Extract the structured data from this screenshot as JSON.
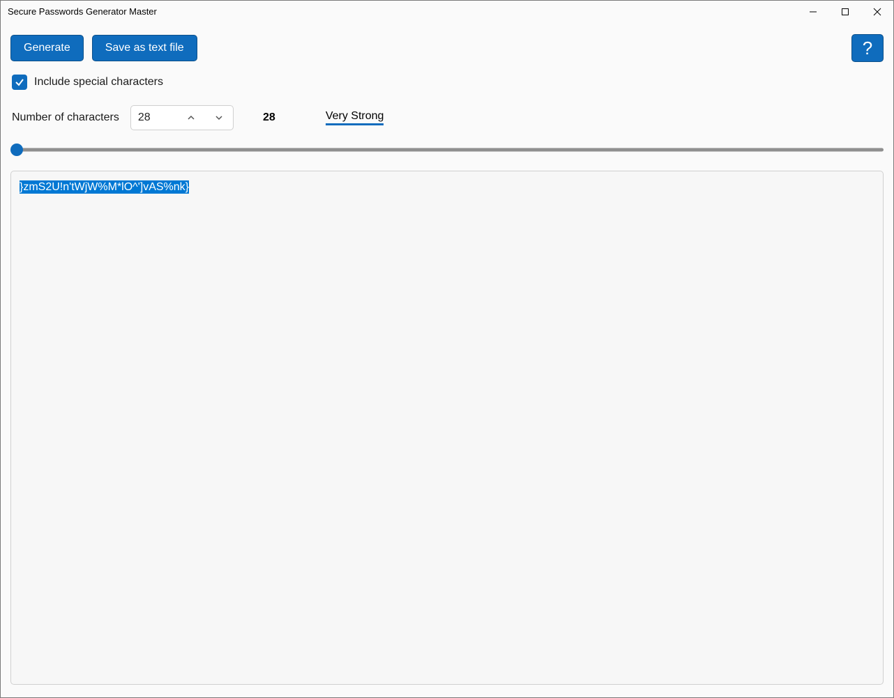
{
  "window": {
    "title": "Secure Passwords Generator Master"
  },
  "toolbar": {
    "generate_label": "Generate",
    "save_label": "Save as text file",
    "help_label": "?"
  },
  "options": {
    "include_special_label": "Include special characters",
    "include_special_checked": true,
    "num_chars_label": "Number of characters",
    "num_chars_value": "28",
    "num_chars_display": "28",
    "strength_label": "Very Strong"
  },
  "output": {
    "password": "}zmS2U!n'tWjW%M*lO^']vAS%nk}"
  },
  "colors": {
    "accent": "#0f6cbd",
    "selection": "#0078d4"
  }
}
